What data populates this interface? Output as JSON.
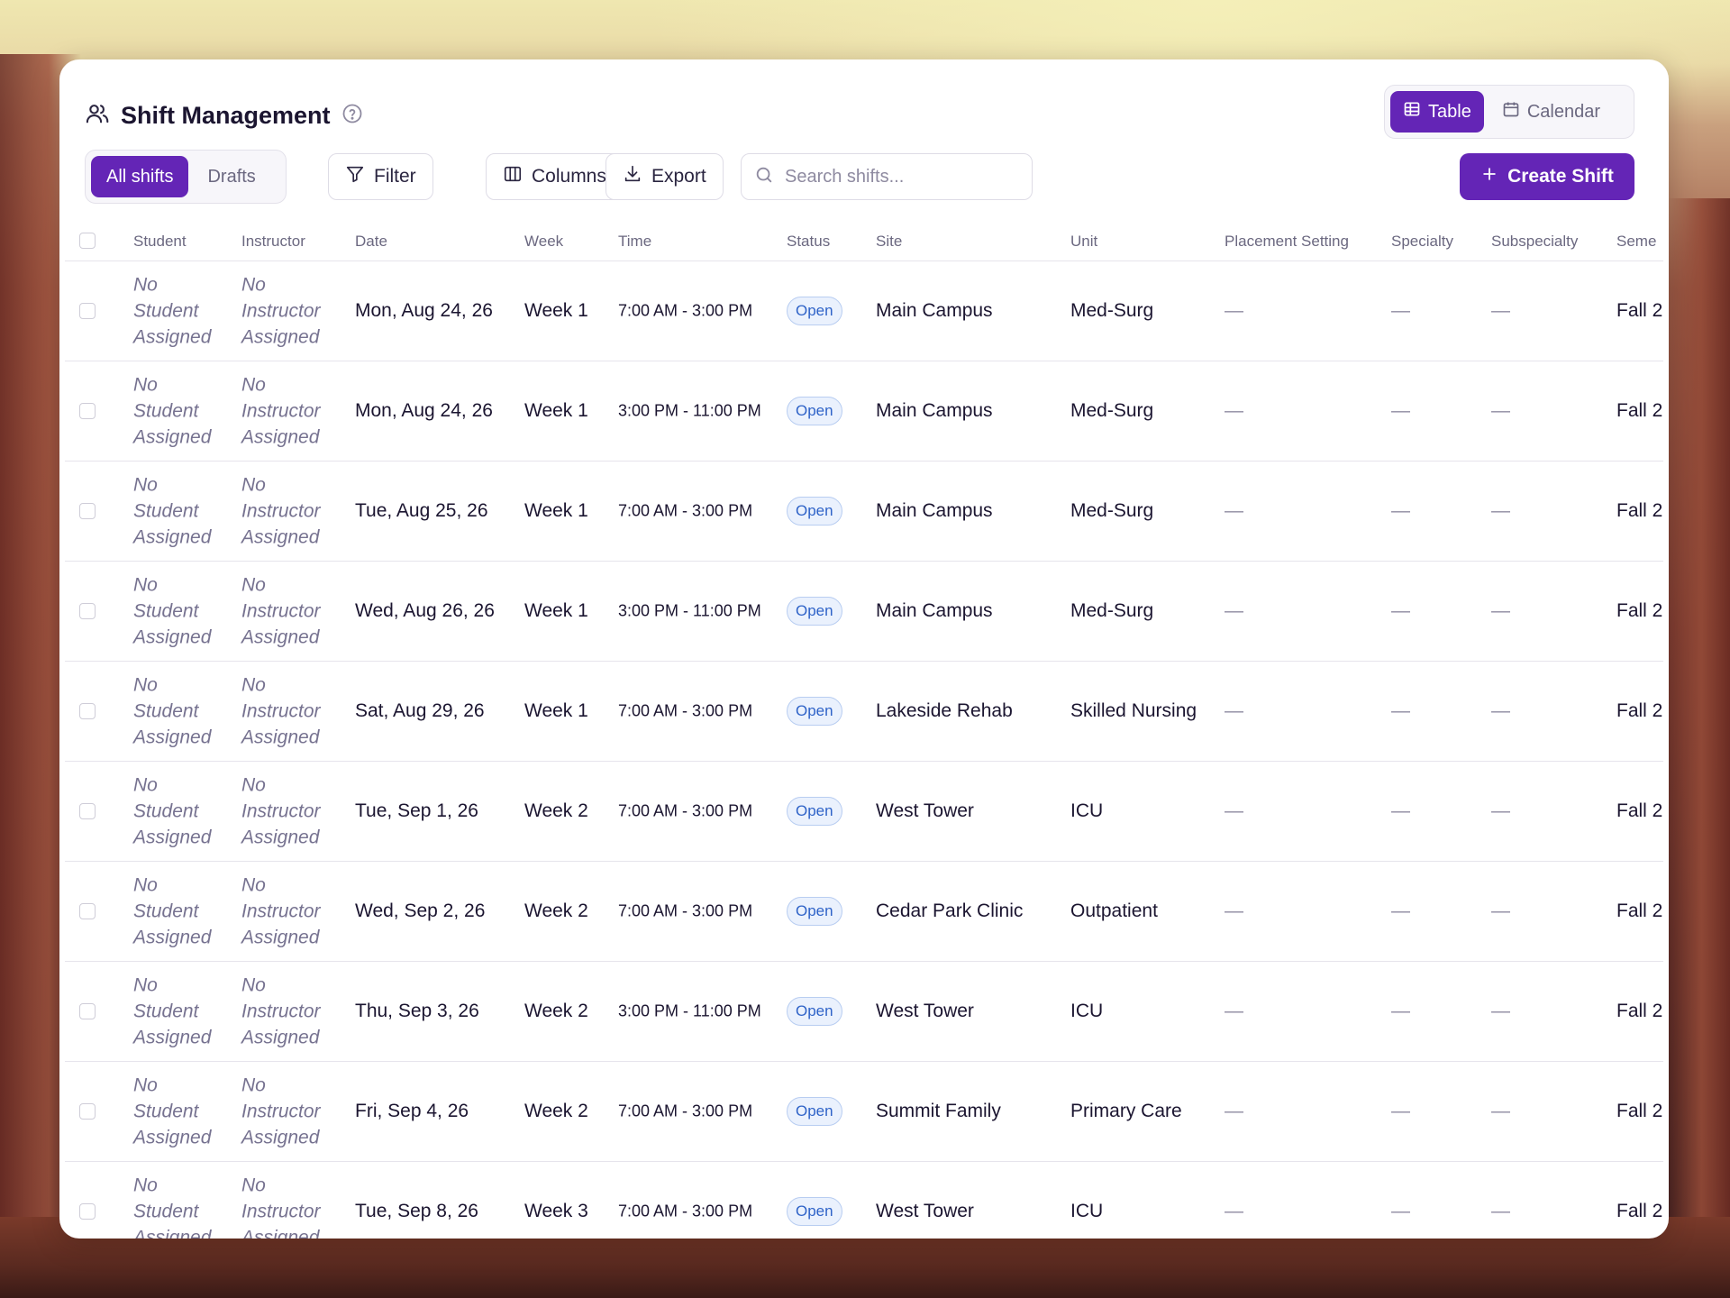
{
  "header": {
    "title": "Shift Management"
  },
  "view_toggle": {
    "table_label": "Table",
    "calendar_label": "Calendar",
    "active": "Table"
  },
  "toolbar": {
    "all_shifts_label": "All shifts",
    "drafts_label": "Drafts",
    "filter_label": "Filter",
    "columns_label": "Columns",
    "export_label": "Export",
    "search_placeholder": "Search shifts...",
    "search_value": "",
    "create_label": "Create Shift"
  },
  "colors": {
    "accent": "#6425b6",
    "status_open_border": "#b8cdf1",
    "status_open_text": "#2f63c8"
  },
  "table": {
    "columns": [
      "Student",
      "Instructor",
      "Date",
      "Week",
      "Time",
      "Status",
      "Site",
      "Unit",
      "Placement Setting",
      "Specialty",
      "Subspecialty",
      "Seme"
    ],
    "rows": [
      {
        "student": "No Student Assigned",
        "instructor": "No Instructor Assigned",
        "date": "Mon, Aug 24, 26",
        "week": "Week 1",
        "time": "7:00 AM - 3:00 PM",
        "status": "Open",
        "site": "Main Campus",
        "unit": "Med-Surg",
        "placement": "—",
        "specialty": "—",
        "subspecialty": "—",
        "semester": "Fall 2"
      },
      {
        "student": "No Student Assigned",
        "instructor": "No Instructor Assigned",
        "date": "Mon, Aug 24, 26",
        "week": "Week 1",
        "time": "3:00 PM - 11:00 PM",
        "status": "Open",
        "site": "Main Campus",
        "unit": "Med-Surg",
        "placement": "—",
        "specialty": "—",
        "subspecialty": "—",
        "semester": "Fall 2"
      },
      {
        "student": "No Student Assigned",
        "instructor": "No Instructor Assigned",
        "date": "Tue, Aug 25, 26",
        "week": "Week 1",
        "time": "7:00 AM - 3:00 PM",
        "status": "Open",
        "site": "Main Campus",
        "unit": "Med-Surg",
        "placement": "—",
        "specialty": "—",
        "subspecialty": "—",
        "semester": "Fall 2"
      },
      {
        "student": "No Student Assigned",
        "instructor": "No Instructor Assigned",
        "date": "Wed, Aug 26, 26",
        "week": "Week 1",
        "time": "3:00 PM - 11:00 PM",
        "status": "Open",
        "site": "Main Campus",
        "unit": "Med-Surg",
        "placement": "—",
        "specialty": "—",
        "subspecialty": "—",
        "semester": "Fall 2"
      },
      {
        "student": "No Student Assigned",
        "instructor": "No Instructor Assigned",
        "date": "Sat, Aug 29, 26",
        "week": "Week 1",
        "time": "7:00 AM - 3:00 PM",
        "status": "Open",
        "site": "Lakeside Rehab",
        "unit": "Skilled Nursing",
        "placement": "—",
        "specialty": "—",
        "subspecialty": "—",
        "semester": "Fall 2"
      },
      {
        "student": "No Student Assigned",
        "instructor": "No Instructor Assigned",
        "date": "Tue, Sep 1, 26",
        "week": "Week 2",
        "time": "7:00 AM - 3:00 PM",
        "status": "Open",
        "site": "West Tower",
        "unit": "ICU",
        "placement": "—",
        "specialty": "—",
        "subspecialty": "—",
        "semester": "Fall 2"
      },
      {
        "student": "No Student Assigned",
        "instructor": "No Instructor Assigned",
        "date": "Wed, Sep 2, 26",
        "week": "Week 2",
        "time": "7:00 AM - 3:00 PM",
        "status": "Open",
        "site": "Cedar Park Clinic",
        "unit": "Outpatient",
        "placement": "—",
        "specialty": "—",
        "subspecialty": "—",
        "semester": "Fall 2"
      },
      {
        "student": "No Student Assigned",
        "instructor": "No Instructor Assigned",
        "date": "Thu, Sep 3, 26",
        "week": "Week 2",
        "time": "3:00 PM - 11:00 PM",
        "status": "Open",
        "site": "West Tower",
        "unit": "ICU",
        "placement": "—",
        "specialty": "—",
        "subspecialty": "—",
        "semester": "Fall 2"
      },
      {
        "student": "No Student Assigned",
        "instructor": "No Instructor Assigned",
        "date": "Fri, Sep 4, 26",
        "week": "Week 2",
        "time": "7:00 AM - 3:00 PM",
        "status": "Open",
        "site": "Summit Family",
        "unit": "Primary Care",
        "placement": "—",
        "specialty": "—",
        "subspecialty": "—",
        "semester": "Fall 2"
      },
      {
        "student": "No Student Assigned",
        "instructor": "No Instructor Assigned",
        "date": "Tue, Sep 8, 26",
        "week": "Week 3",
        "time": "7:00 AM - 3:00 PM",
        "status": "Open",
        "site": "West Tower",
        "unit": "ICU",
        "placement": "—",
        "specialty": "—",
        "subspecialty": "—",
        "semester": "Fall 2"
      }
    ]
  }
}
